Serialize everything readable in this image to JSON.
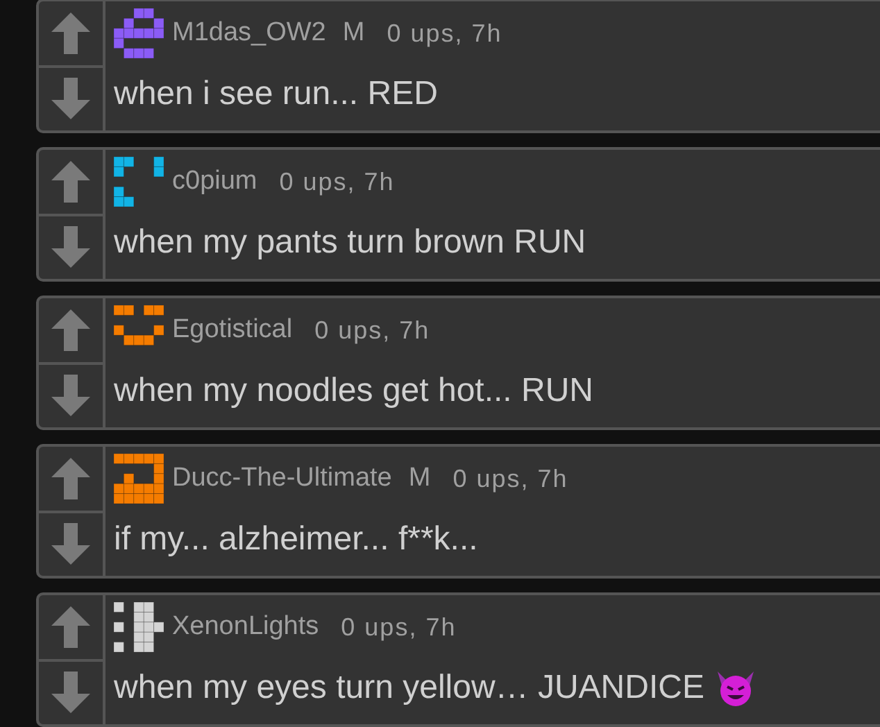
{
  "comments": [
    {
      "author": "M1das_OW2",
      "color": "#8b5cf6",
      "badge": "M",
      "meta": "0 ups, 7h",
      "text": "when i see run... RED"
    },
    {
      "author": "c0pium",
      "color": "#12b4e6",
      "meta": "0 ups, 7h",
      "text": "when my pants turn brown RUN"
    },
    {
      "author": "Egotistical",
      "color": "#f57c00",
      "meta": "0 ups, 7h",
      "text": "when my noodles get hot... RUN"
    },
    {
      "author": "Ducc-The-Ultimate",
      "color": "#f57c00",
      "badge": "M",
      "meta": "0 ups, 7h",
      "text": "if my... alzheimer... f**k..."
    },
    {
      "author": "XenonLights",
      "color": "#d4d4d4",
      "meta": "0 ups, 7h",
      "text": "when my eyes turn yellow… JUANDICE",
      "emoji": true
    }
  ]
}
